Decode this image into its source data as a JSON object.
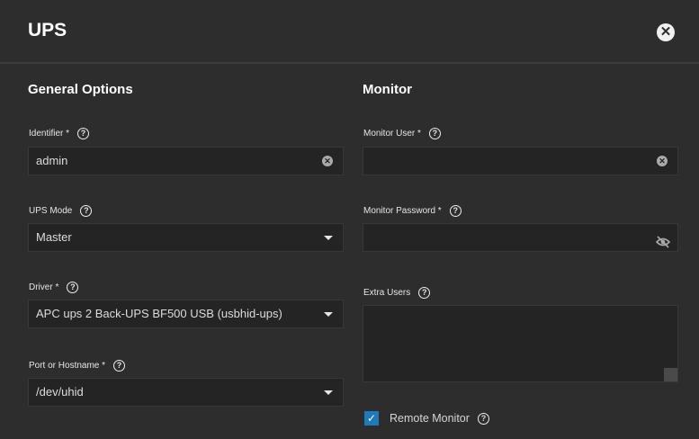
{
  "dialog": {
    "title": "UPS"
  },
  "general": {
    "heading": "General Options",
    "identifier": {
      "label": "Identifier *",
      "value": "admin"
    },
    "ups_mode": {
      "label": "UPS Mode",
      "value": "Master"
    },
    "driver": {
      "label": "Driver *",
      "value": "APC ups 2 Back-UPS BF500 USB (usbhid-ups)"
    },
    "port": {
      "label": "Port or Hostname *",
      "value": "/dev/uhid"
    }
  },
  "monitor": {
    "heading": "Monitor",
    "user": {
      "label": "Monitor User *",
      "value": ""
    },
    "password": {
      "label": "Monitor Password *",
      "value": ""
    },
    "extra_users": {
      "label": "Extra Users",
      "value": ""
    },
    "remote_monitor": {
      "label": "Remote Monitor",
      "checked": true
    }
  },
  "icons": {
    "help": "?",
    "close": "✕",
    "clear": "✕",
    "check": "✓",
    "eye_off": "👁"
  }
}
